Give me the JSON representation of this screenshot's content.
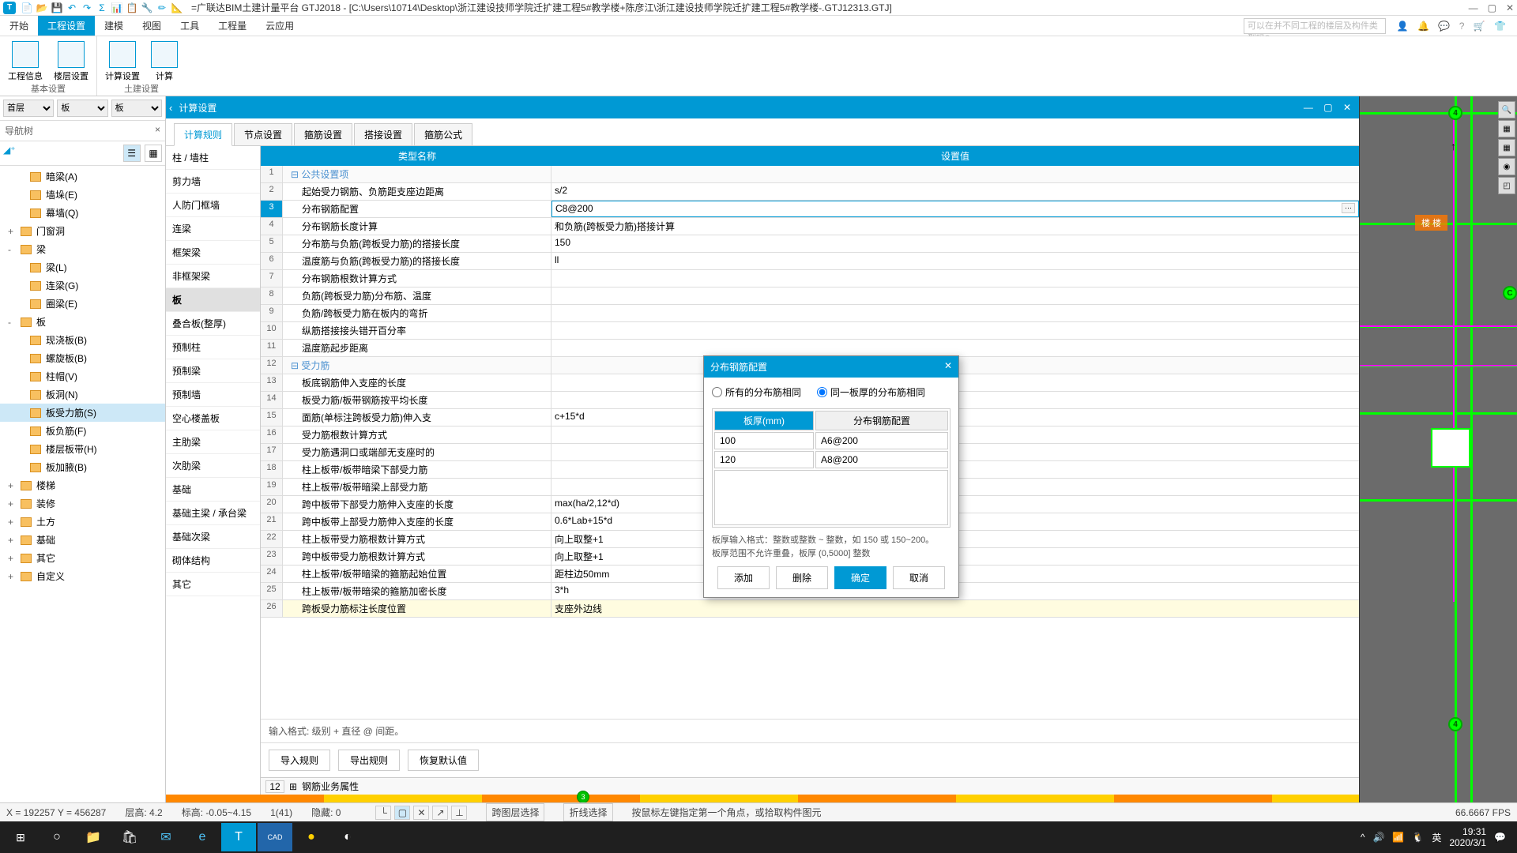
{
  "title": "=广联达BIM土建计量平台 GTJ2018 - [C:\\Users\\10714\\Desktop\\浙江建设技师学院迁扩建工程5#教学楼+陈彦江\\浙江建设技师学院迁扩建工程5#教学楼-.GTJ12313.GTJ]",
  "menubar": {
    "items": [
      "开始",
      "工程设置",
      "建模",
      "视图",
      "工具",
      "工程量",
      "云应用"
    ],
    "search_placeholder": "可以在并不同工程的楼层及构件类型吗?"
  },
  "ribbon": {
    "group1": {
      "btns": [
        "工程信息",
        "楼层设置"
      ],
      "label": "基本设置"
    },
    "group2": {
      "btns": [
        "计算设置",
        "计算"
      ],
      "label": "土建设置"
    }
  },
  "left": {
    "floor": "首层",
    "category": "板",
    "nav_title": "导航树",
    "tree": [
      {
        "lvl": 2,
        "label": "暗梁(A)"
      },
      {
        "lvl": 2,
        "label": "墙垛(E)"
      },
      {
        "lvl": 2,
        "label": "幕墙(Q)"
      },
      {
        "lvl": 1,
        "label": "门窗洞",
        "exp": "+"
      },
      {
        "lvl": 1,
        "label": "梁",
        "exp": "-"
      },
      {
        "lvl": 2,
        "label": "梁(L)"
      },
      {
        "lvl": 2,
        "label": "连梁(G)"
      },
      {
        "lvl": 2,
        "label": "圈梁(E)"
      },
      {
        "lvl": 1,
        "label": "板",
        "exp": "-"
      },
      {
        "lvl": 2,
        "label": "现浇板(B)"
      },
      {
        "lvl": 2,
        "label": "螺旋板(B)"
      },
      {
        "lvl": 2,
        "label": "柱帽(V)"
      },
      {
        "lvl": 2,
        "label": "板洞(N)"
      },
      {
        "lvl": 2,
        "label": "板受力筋(S)",
        "selected": true
      },
      {
        "lvl": 2,
        "label": "板负筋(F)"
      },
      {
        "lvl": 2,
        "label": "楼层板带(H)"
      },
      {
        "lvl": 2,
        "label": "板加腋(B)"
      },
      {
        "lvl": 1,
        "label": "楼梯",
        "exp": "+"
      },
      {
        "lvl": 1,
        "label": "装修",
        "exp": "+"
      },
      {
        "lvl": 1,
        "label": "土方",
        "exp": "+"
      },
      {
        "lvl": 1,
        "label": "基础",
        "exp": "+"
      },
      {
        "lvl": 1,
        "label": "其它",
        "exp": "+"
      },
      {
        "lvl": 1,
        "label": "自定义",
        "exp": "+"
      }
    ]
  },
  "calc": {
    "title": "计算设置",
    "tabs": [
      "计算规则",
      "节点设置",
      "箍筋设置",
      "搭接设置",
      "箍筋公式"
    ],
    "categories": [
      "柱 / 墙柱",
      "剪力墙",
      "人防门框墙",
      "连梁",
      "框架梁",
      "非框架梁",
      "板",
      "叠合板(整厚)",
      "预制柱",
      "预制梁",
      "预制墙",
      "空心楼盖板",
      "主肋梁",
      "次肋梁",
      "基础",
      "基础主梁 / 承台梁",
      "基础次梁",
      "砌体结构",
      "其它"
    ],
    "cat_selected": 6,
    "header_name": "类型名称",
    "header_val": "设置值",
    "rows": [
      {
        "n": 1,
        "name": "公共设置项",
        "group": true
      },
      {
        "n": 2,
        "name": "起始受力钢筋、负筋距支座边距离",
        "val": "s/2"
      },
      {
        "n": 3,
        "name": "分布钢筋配置",
        "val": "C8@200",
        "selected": true
      },
      {
        "n": 4,
        "name": "分布钢筋长度计算",
        "val": "和负筋(跨板受力筋)搭接计算"
      },
      {
        "n": 5,
        "name": "分布筋与负筋(跨板受力筋)的搭接长度",
        "val": "150"
      },
      {
        "n": 6,
        "name": "温度筋与负筋(跨板受力筋)的搭接长度",
        "val": "ll"
      },
      {
        "n": 7,
        "name": "分布钢筋根数计算方式",
        "val": ""
      },
      {
        "n": 8,
        "name": "负筋(跨板受力筋)分布筋、温度",
        "val": ""
      },
      {
        "n": 9,
        "name": "负筋/跨板受力筋在板内的弯折",
        "val": ""
      },
      {
        "n": 10,
        "name": "纵筋搭接接头错开百分率",
        "val": ""
      },
      {
        "n": 11,
        "name": "温度筋起步距离",
        "val": ""
      },
      {
        "n": 12,
        "name": "受力筋",
        "group": true
      },
      {
        "n": 13,
        "name": "板底钢筋伸入支座的长度",
        "val": ""
      },
      {
        "n": 14,
        "name": "板受力筋/板带钢筋按平均长度",
        "val": ""
      },
      {
        "n": 15,
        "name": "面筋(单标注跨板受力筋)伸入支",
        "val": "c+15*d"
      },
      {
        "n": 16,
        "name": "受力筋根数计算方式",
        "val": ""
      },
      {
        "n": 17,
        "name": "受力筋遇洞口或端部无支座时的",
        "val": ""
      },
      {
        "n": 18,
        "name": "柱上板带/板带暗梁下部受力筋",
        "val": ""
      },
      {
        "n": 19,
        "name": "柱上板带/板带暗梁上部受力筋",
        "val": ""
      },
      {
        "n": 20,
        "name": "跨中板带下部受力筋伸入支座的长度",
        "val": "max(ha/2,12*d)"
      },
      {
        "n": 21,
        "name": "跨中板带上部受力筋伸入支座的长度",
        "val": "0.6*Lab+15*d"
      },
      {
        "n": 22,
        "name": "柱上板带受力筋根数计算方式",
        "val": "向上取整+1"
      },
      {
        "n": 23,
        "name": "跨中板带受力筋根数计算方式",
        "val": "向上取整+1"
      },
      {
        "n": 24,
        "name": "柱上板带/板带暗梁的箍筋起始位置",
        "val": "距柱边50mm"
      },
      {
        "n": 25,
        "name": "柱上板带/板带暗梁的箍筋加密长度",
        "val": "3*h"
      },
      {
        "n": 26,
        "name": "跨板受力筋标注长度位置",
        "val": "支座外边线",
        "highlight": true
      }
    ],
    "footer_hint": "输入格式: 级别 + 直径 @ 间距。",
    "actions": [
      "导入规则",
      "导出规则",
      "恢复默认值"
    ],
    "prop_num": "12",
    "prop_label": "钢筋业务属性"
  },
  "dialog": {
    "title": "分布钢筋配置",
    "radio1": "所有的分布筋相同",
    "radio2": "同一板厚的分布筋相同",
    "th1": "板厚(mm)",
    "th2": "分布钢筋配置",
    "rows": [
      {
        "a": "100",
        "b": "A6@200"
      },
      {
        "a": "120",
        "b": "A8@200"
      }
    ],
    "hint": "板厚输入格式：整数或整数 ~ 整数，如 150 或 150~200。\n板厚范围不允许重叠，板厚 (0,5000] 整数",
    "btns": {
      "add": "添加",
      "del": "删除",
      "ok": "确定",
      "cancel": "取消"
    }
  },
  "status": {
    "coord": "X = 192257 Y = 456287",
    "floor": "层高:   4.2",
    "elev": "标高:   -0.05~4.15",
    "count": "1(41)",
    "hidden": "隐藏:   0",
    "btn1": "跨图层选择",
    "btn2": "折线选择",
    "hint": "按鼠标左键指定第一个角点，或拾取构件图元",
    "fps": "66.6667 FPS"
  },
  "taskbar": {
    "ime": "英",
    "time": "19:31",
    "date": "2020/3/1"
  }
}
